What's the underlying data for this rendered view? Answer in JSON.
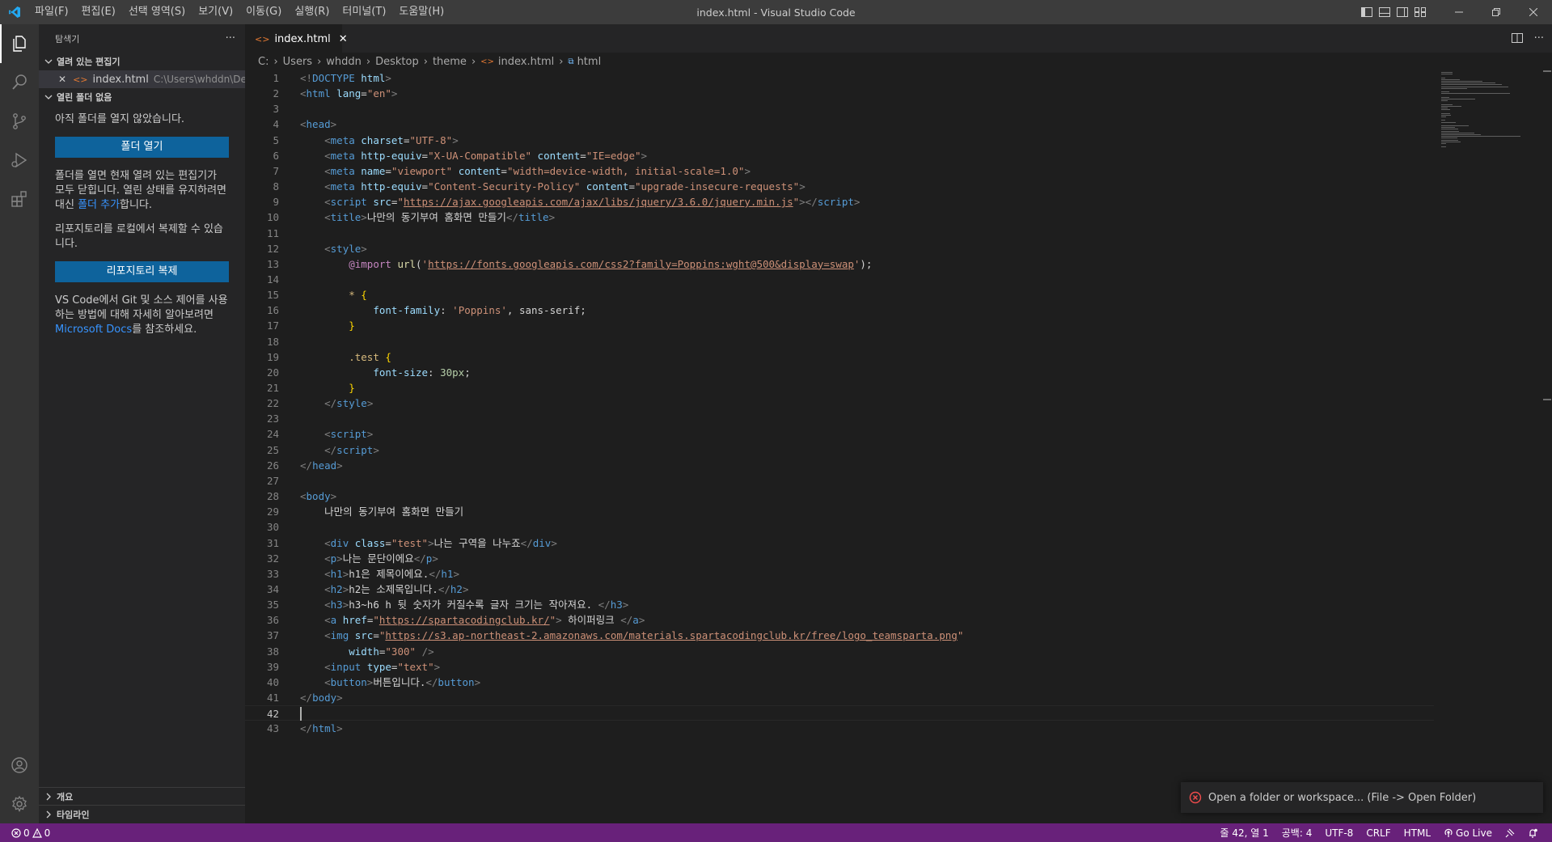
{
  "window": {
    "title": "index.html - Visual Studio Code",
    "menu": [
      "파일(F)",
      "편집(E)",
      "선택 영역(S)",
      "보기(V)",
      "이동(G)",
      "실행(R)",
      "터미널(T)",
      "도움말(H)"
    ]
  },
  "sidebar": {
    "title": "탐색기",
    "more": "···",
    "open_editors_header": "열려 있는 편집기",
    "open_editor": {
      "name": "index.html",
      "path": "C:\\Users\\whddn\\Desk..."
    },
    "no_folder_header": "열린 폴더 없음",
    "msg1": "아직 폴더를 열지 않았습니다.",
    "open_folder_button": "폴더 열기",
    "msg2_a": "폴더를 열면 현재 열려 있는 편집기가 모두 닫힙니다. 열린 상태를 유지하려면 대신 ",
    "msg2_link": "폴더 추가",
    "msg2_b": "합니다.",
    "msg3": "리포지토리를 로컬에서 복제할 수 있습니다.",
    "clone_button": "리포지토리 복제",
    "msg4_a": "VS Code에서 Git 및 소스 제어를 사용하는 방법에 대해 자세히 알아보려면 ",
    "msg4_link": "Microsoft Docs",
    "msg4_b": "를 참조하세요.",
    "outline": "개요",
    "timeline": "타임라인"
  },
  "tab": {
    "label": "index.html",
    "close": "✕"
  },
  "breadcrumb": [
    "C:",
    "Users",
    "whddn",
    "Desktop",
    "theme",
    "index.html",
    "html"
  ],
  "editor": {
    "current_line": 42,
    "lines": [
      [
        [
          "t",
          "<!"
        ],
        [
          "tn",
          "DOCTYPE"
        ],
        [
          "d",
          " "
        ],
        [
          "an",
          "html"
        ],
        [
          "t",
          ">"
        ]
      ],
      [
        [
          "t",
          "<"
        ],
        [
          "tn",
          "html"
        ],
        [
          "d",
          " "
        ],
        [
          "an",
          "lang"
        ],
        [
          "d",
          "="
        ],
        [
          "av",
          "\"en\""
        ],
        [
          "t",
          ">"
        ]
      ],
      [],
      [
        [
          "t",
          "<"
        ],
        [
          "tn",
          "head"
        ],
        [
          "t",
          ">"
        ]
      ],
      [
        [
          "d",
          "    "
        ],
        [
          "t",
          "<"
        ],
        [
          "tn",
          "meta"
        ],
        [
          "d",
          " "
        ],
        [
          "an",
          "charset"
        ],
        [
          "d",
          "="
        ],
        [
          "av",
          "\"UTF-8\""
        ],
        [
          "t",
          ">"
        ]
      ],
      [
        [
          "d",
          "    "
        ],
        [
          "t",
          "<"
        ],
        [
          "tn",
          "meta"
        ],
        [
          "d",
          " "
        ],
        [
          "an",
          "http-equiv"
        ],
        [
          "d",
          "="
        ],
        [
          "av",
          "\"X-UA-Compatible\""
        ],
        [
          "d",
          " "
        ],
        [
          "an",
          "content"
        ],
        [
          "d",
          "="
        ],
        [
          "av",
          "\"IE=edge\""
        ],
        [
          "t",
          ">"
        ]
      ],
      [
        [
          "d",
          "    "
        ],
        [
          "t",
          "<"
        ],
        [
          "tn",
          "meta"
        ],
        [
          "d",
          " "
        ],
        [
          "an",
          "name"
        ],
        [
          "d",
          "="
        ],
        [
          "av",
          "\"viewport\""
        ],
        [
          "d",
          " "
        ],
        [
          "an",
          "content"
        ],
        [
          "d",
          "="
        ],
        [
          "av",
          "\"width=device-width, initial-scale=1.0\""
        ],
        [
          "t",
          ">"
        ]
      ],
      [
        [
          "d",
          "    "
        ],
        [
          "t",
          "<"
        ],
        [
          "tn",
          "meta"
        ],
        [
          "d",
          " "
        ],
        [
          "an",
          "http-equiv"
        ],
        [
          "d",
          "="
        ],
        [
          "av",
          "\"Content-Security-Policy\""
        ],
        [
          "d",
          " "
        ],
        [
          "an",
          "content"
        ],
        [
          "d",
          "="
        ],
        [
          "av",
          "\"upgrade-insecure-requests\""
        ],
        [
          "t",
          ">"
        ]
      ],
      [
        [
          "d",
          "    "
        ],
        [
          "t",
          "<"
        ],
        [
          "tn",
          "script"
        ],
        [
          "d",
          " "
        ],
        [
          "an",
          "src"
        ],
        [
          "d",
          "="
        ],
        [
          "av",
          "\""
        ],
        [
          "avu",
          "https://ajax.googleapis.com/ajax/libs/jquery/3.6.0/jquery.min.js"
        ],
        [
          "av",
          "\""
        ],
        [
          "t",
          "></"
        ],
        [
          "tn",
          "script"
        ],
        [
          "t",
          ">"
        ]
      ],
      [
        [
          "d",
          "    "
        ],
        [
          "t",
          "<"
        ],
        [
          "tn",
          "title"
        ],
        [
          "t",
          ">"
        ],
        [
          "d",
          "나만의 동기부여 홈화면 만들기"
        ],
        [
          "t",
          "</"
        ],
        [
          "tn",
          "title"
        ],
        [
          "t",
          ">"
        ]
      ],
      [],
      [
        [
          "d",
          "    "
        ],
        [
          "t",
          "<"
        ],
        [
          "tn",
          "style"
        ],
        [
          "t",
          ">"
        ]
      ],
      [
        [
          "d",
          "        "
        ],
        [
          "kw",
          "@import"
        ],
        [
          "d",
          " "
        ],
        [
          "fn",
          "url"
        ],
        [
          "d",
          "("
        ],
        [
          "av",
          "'"
        ],
        [
          "avu",
          "https://fonts.googleapis.com/css2?family=Poppins:wght@500&display=swap"
        ],
        [
          "av",
          "'"
        ],
        [
          "d",
          ");"
        ]
      ],
      [],
      [
        [
          "d",
          "        "
        ],
        [
          "sel",
          "*"
        ],
        [
          "d",
          " "
        ],
        [
          "br",
          "{"
        ]
      ],
      [
        [
          "d",
          "            "
        ],
        [
          "pr",
          "font-family"
        ],
        [
          "d",
          ": "
        ],
        [
          "av",
          "'Poppins'"
        ],
        [
          "d",
          ", sans-serif;"
        ]
      ],
      [
        [
          "d",
          "        "
        ],
        [
          "br",
          "}"
        ]
      ],
      [],
      [
        [
          "d",
          "        "
        ],
        [
          "sel",
          ".test"
        ],
        [
          "d",
          " "
        ],
        [
          "br",
          "{"
        ]
      ],
      [
        [
          "d",
          "            "
        ],
        [
          "pr",
          "font-size"
        ],
        [
          "d",
          ": "
        ],
        [
          "nu",
          "30px"
        ],
        [
          "d",
          ";"
        ]
      ],
      [
        [
          "d",
          "        "
        ],
        [
          "br",
          "}"
        ]
      ],
      [
        [
          "d",
          "    "
        ],
        [
          "t",
          "</"
        ],
        [
          "tn",
          "style"
        ],
        [
          "t",
          ">"
        ]
      ],
      [],
      [
        [
          "d",
          "    "
        ],
        [
          "t",
          "<"
        ],
        [
          "tn",
          "script"
        ],
        [
          "t",
          ">"
        ]
      ],
      [
        [
          "d",
          "    "
        ],
        [
          "t",
          "</"
        ],
        [
          "tn",
          "script"
        ],
        [
          "t",
          ">"
        ]
      ],
      [
        [
          "t",
          "</"
        ],
        [
          "tn",
          "head"
        ],
        [
          "t",
          ">"
        ]
      ],
      [],
      [
        [
          "t",
          "<"
        ],
        [
          "tn",
          "body"
        ],
        [
          "t",
          ">"
        ]
      ],
      [
        [
          "d",
          "    나만의 동기부여 홈화면 만들기"
        ]
      ],
      [],
      [
        [
          "d",
          "    "
        ],
        [
          "t",
          "<"
        ],
        [
          "tn",
          "div"
        ],
        [
          "d",
          " "
        ],
        [
          "an",
          "class"
        ],
        [
          "d",
          "="
        ],
        [
          "av",
          "\"test\""
        ],
        [
          "t",
          ">"
        ],
        [
          "d",
          "나는 구역을 나누죠"
        ],
        [
          "t",
          "</"
        ],
        [
          "tn",
          "div"
        ],
        [
          "t",
          ">"
        ]
      ],
      [
        [
          "d",
          "    "
        ],
        [
          "t",
          "<"
        ],
        [
          "tn",
          "p"
        ],
        [
          "t",
          ">"
        ],
        [
          "d",
          "나는 문단이에요"
        ],
        [
          "t",
          "</"
        ],
        [
          "tn",
          "p"
        ],
        [
          "t",
          ">"
        ]
      ],
      [
        [
          "d",
          "    "
        ],
        [
          "t",
          "<"
        ],
        [
          "tn",
          "h1"
        ],
        [
          "t",
          ">"
        ],
        [
          "d",
          "h1은 제목이에요."
        ],
        [
          "t",
          "</"
        ],
        [
          "tn",
          "h1"
        ],
        [
          "t",
          ">"
        ]
      ],
      [
        [
          "d",
          "    "
        ],
        [
          "t",
          "<"
        ],
        [
          "tn",
          "h2"
        ],
        [
          "t",
          ">"
        ],
        [
          "d",
          "h2는 소제목입니다."
        ],
        [
          "t",
          "</"
        ],
        [
          "tn",
          "h2"
        ],
        [
          "t",
          ">"
        ]
      ],
      [
        [
          "d",
          "    "
        ],
        [
          "t",
          "<"
        ],
        [
          "tn",
          "h3"
        ],
        [
          "t",
          ">"
        ],
        [
          "d",
          "h3~h6 h 뒷 숫자가 커질수록 글자 크기는 작아져요. "
        ],
        [
          "t",
          "</"
        ],
        [
          "tn",
          "h3"
        ],
        [
          "t",
          ">"
        ]
      ],
      [
        [
          "d",
          "    "
        ],
        [
          "t",
          "<"
        ],
        [
          "tn",
          "a"
        ],
        [
          "d",
          " "
        ],
        [
          "an",
          "href"
        ],
        [
          "d",
          "="
        ],
        [
          "av",
          "\""
        ],
        [
          "avu",
          "https://spartacodingclub.kr/"
        ],
        [
          "av",
          "\""
        ],
        [
          "t",
          ">"
        ],
        [
          "d",
          " 하이퍼링크 "
        ],
        [
          "t",
          "</"
        ],
        [
          "tn",
          "a"
        ],
        [
          "t",
          ">"
        ]
      ],
      [
        [
          "d",
          "    "
        ],
        [
          "t",
          "<"
        ],
        [
          "tn",
          "img"
        ],
        [
          "d",
          " "
        ],
        [
          "an",
          "src"
        ],
        [
          "d",
          "="
        ],
        [
          "av",
          "\""
        ],
        [
          "avu",
          "https://s3.ap-northeast-2.amazonaws.com/materials.spartacodingclub.kr/free/logo_teamsparta.png"
        ],
        [
          "av",
          "\""
        ]
      ],
      [
        [
          "d",
          "        "
        ],
        [
          "an",
          "width"
        ],
        [
          "d",
          "="
        ],
        [
          "av",
          "\"300\""
        ],
        [
          "d",
          " "
        ],
        [
          "t",
          "/>"
        ]
      ],
      [
        [
          "d",
          "    "
        ],
        [
          "t",
          "<"
        ],
        [
          "tn",
          "input"
        ],
        [
          "d",
          " "
        ],
        [
          "an",
          "type"
        ],
        [
          "d",
          "="
        ],
        [
          "av",
          "\"text\""
        ],
        [
          "t",
          ">"
        ]
      ],
      [
        [
          "d",
          "    "
        ],
        [
          "t",
          "<"
        ],
        [
          "tn",
          "button"
        ],
        [
          "t",
          ">"
        ],
        [
          "d",
          "버튼입니다."
        ],
        [
          "t",
          "</"
        ],
        [
          "tn",
          "button"
        ],
        [
          "t",
          ">"
        ]
      ],
      [
        [
          "t",
          "</"
        ],
        [
          "tn",
          "body"
        ],
        [
          "t",
          ">"
        ]
      ],
      [],
      [
        [
          "t",
          "</"
        ],
        [
          "tn",
          "html"
        ],
        [
          "t",
          ">"
        ]
      ]
    ]
  },
  "notification": "Open a folder or workspace... (File -> Open Folder)",
  "statusbar": {
    "errors": "0",
    "warnings": "0",
    "position": "줄 42, 열 1",
    "spaces": "공백: 4",
    "encoding": "UTF-8",
    "eol": "CRLF",
    "language": "HTML",
    "golive": "Go Live"
  },
  "colors": {
    "statusbar": "#68217a",
    "accent": "#0e639c",
    "link": "#3794ff"
  }
}
